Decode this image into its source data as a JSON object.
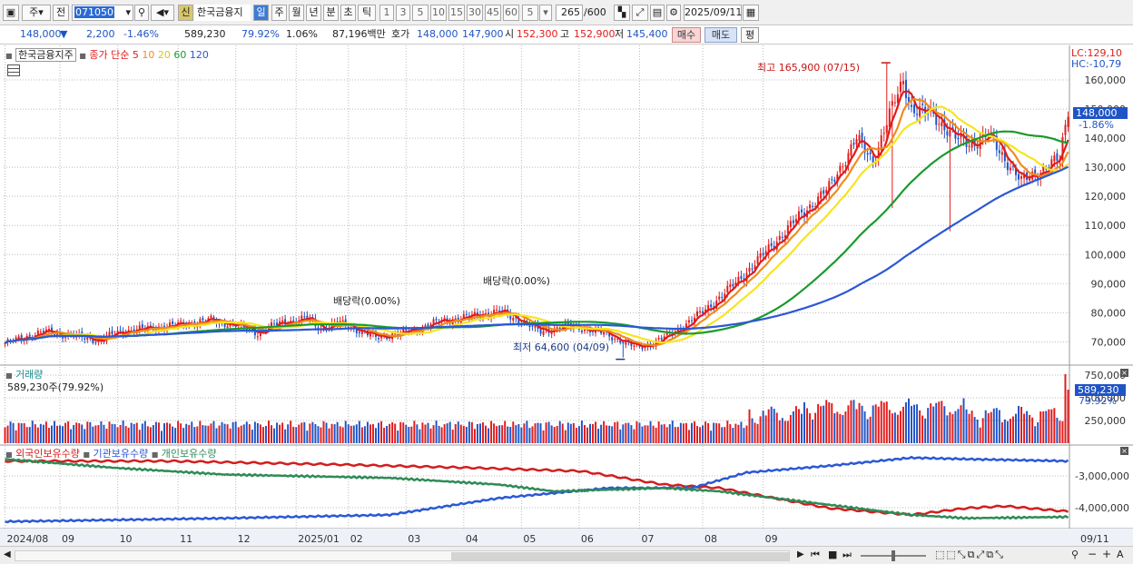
{
  "toolbar": {
    "market_label": "주",
    "prev_label": "전",
    "stock_code": "071050",
    "stock_name": "한국금융지",
    "new_badge": "신",
    "periods": [
      "일",
      "주",
      "월",
      "년",
      "분",
      "초",
      "틱"
    ],
    "minute_buttons": [
      "1",
      "3",
      "5",
      "10",
      "15",
      "30",
      "45",
      "60"
    ],
    "custom_period": "5",
    "count_value": "265",
    "count_total": "/600",
    "date_value": "2025/09/11"
  },
  "info": {
    "price": "148,000",
    "down_arrow": "▼",
    "change": "2,200",
    "change_pct": "-1.46%",
    "volume": "589,230",
    "volume_ratio": "79.92%",
    "turnover_rate": "1.06%",
    "trade_amount": "87,196백만",
    "bid_label": "호가",
    "bid_price": "148,000",
    "ask_price": "147,900",
    "open_label": "시",
    "open_price": "152,300",
    "high_label": "고",
    "high_price": "152,900",
    "low_label": "저",
    "low_price": "145,400",
    "buy_label": "매수",
    "sell_label": "매도",
    "eval_label": "평"
  },
  "main_legend": {
    "name": "한국금융지주",
    "ma_title": "종가 단순",
    "ma5": "5",
    "ma10": "10",
    "ma20": "20",
    "ma60": "60",
    "ma120": "120"
  },
  "main_right": {
    "lc": "LC:129,10",
    "hc": "HC:-10,79",
    "current_price": "148,000",
    "current_change": "-1.86%"
  },
  "annotations": {
    "high": "최고 165,900 (07/15)",
    "low": "최저 64,600 (04/09)",
    "dividend1": "배당락(0.00%)",
    "dividend2": "배당락(0.00%)"
  },
  "volume_legend": {
    "title": "거래량",
    "value": "589,230주(79.92%)",
    "current": "589,230",
    "current_pct": "79.92%"
  },
  "holding_legend": {
    "foreign": "외국인보유수량",
    "institution": "기관보유수량",
    "individual": "개인보유수량"
  },
  "x_labels": [
    "2024/08",
    "09",
    "10",
    "11",
    "12",
    "2025/01",
    "02",
    "03",
    "04",
    "05",
    "06",
    "07",
    "08",
    "09",
    "09/11"
  ],
  "colors": {
    "up": "#e21b1b",
    "down": "#1f54c6",
    "ma5": "#e21b1b",
    "ma10": "#f08c1e",
    "ma20": "#f5e51e",
    "ma60": "#1a9a2c",
    "ma120": "#2b58d6",
    "institution": "#2b58d6",
    "foreign": "#d21e1e",
    "individual": "#2e8b57"
  },
  "chart_data": [
    {
      "type": "candlestick",
      "title": "한국금융지주",
      "ylim": [
        62000,
        170000
      ],
      "y_ticks": [
        70000,
        80000,
        90000,
        100000,
        110000,
        120000,
        130000,
        140000,
        150000,
        160000
      ],
      "y_tick_labels": [
        "70,000",
        "80,000",
        "90,000",
        "100,000",
        "110,000",
        "120,000",
        "130,000",
        "140,000",
        "150,000",
        "160,000"
      ],
      "grid": true,
      "anchors": [
        [
          0,
          69500
        ],
        [
          14,
          73500
        ],
        [
          25,
          72000
        ],
        [
          34,
          70500
        ],
        [
          42,
          73500
        ],
        [
          60,
          75500
        ],
        [
          75,
          77500
        ],
        [
          85,
          75500
        ],
        [
          92,
          73000
        ],
        [
          100,
          76500
        ],
        [
          110,
          78000
        ],
        [
          115,
          74500
        ],
        [
          122,
          76500
        ],
        [
          135,
          71500
        ],
        [
          144,
          73000
        ],
        [
          150,
          74500
        ],
        [
          158,
          77000
        ],
        [
          168,
          78500
        ],
        [
          180,
          80500
        ],
        [
          188,
          77000
        ],
        [
          195,
          73500
        ],
        [
          206,
          75500
        ],
        [
          218,
          73000
        ],
        [
          230,
          68000
        ],
        [
          237,
          70000
        ],
        [
          248,
          76000
        ],
        [
          260,
          85000
        ],
        [
          270,
          94000
        ],
        [
          280,
          104000
        ],
        [
          290,
          114000
        ],
        [
          300,
          123000
        ],
        [
          310,
          140000
        ],
        [
          316,
          132000
        ],
        [
          322,
          148000
        ],
        [
          327,
          160000
        ],
        [
          330,
          150000
        ],
        [
          338,
          148000
        ],
        [
          346,
          140000
        ],
        [
          352,
          138000
        ],
        [
          358,
          141000
        ],
        [
          364,
          133000
        ],
        [
          370,
          125000
        ],
        [
          376,
          128500
        ],
        [
          380,
          130500
        ],
        [
          384,
          133000
        ],
        [
          387,
          150000
        ]
      ],
      "extremes": [
        {
          "label": "최고",
          "value": 165900,
          "date": "07/15"
        },
        {
          "label": "최저",
          "value": 64600,
          "date": "04/09"
        }
      ],
      "series": [
        {
          "name": "5"
        },
        {
          "name": "10"
        },
        {
          "name": "20"
        },
        {
          "name": "60"
        },
        {
          "name": "120"
        }
      ]
    },
    {
      "type": "bar",
      "title": "거래량",
      "ylim": [
        0,
        800000
      ],
      "y_ticks": [
        250000,
        500000,
        750000
      ],
      "y_tick_labels": [
        "250,000",
        "500,000",
        "750,000"
      ],
      "last_value": 589230
    },
    {
      "type": "line",
      "title": "보유수량",
      "y_ticks": [
        -3000000,
        -4000000
      ],
      "y_tick_labels": [
        "-3,000,000",
        "-4,000,000"
      ],
      "series": [
        {
          "name": "외국인보유수량",
          "points": [
            [
              0,
              0.05
            ],
            [
              60,
              0.05
            ],
            [
              120,
              0.1
            ],
            [
              170,
              0.15
            ],
            [
              210,
              0.2
            ],
            [
              240,
              0.4
            ],
            [
              260,
              0.45
            ],
            [
              300,
              0.75
            ],
            [
              330,
              0.85
            ],
            [
              350,
              0.75
            ],
            [
              364,
              0.72
            ],
            [
              387,
              0.8
            ]
          ]
        },
        {
          "name": "기관보유수량",
          "points": [
            [
              0,
              0.95
            ],
            [
              80,
              0.9
            ],
            [
              140,
              0.85
            ],
            [
              180,
              0.6
            ],
            [
              220,
              0.45
            ],
            [
              250,
              0.45
            ],
            [
              270,
              0.22
            ],
            [
              300,
              0.12
            ],
            [
              330,
              0.0
            ],
            [
              350,
              0.02
            ],
            [
              387,
              0.05
            ]
          ]
        },
        {
          "name": "개인보유수량",
          "points": [
            [
              0,
              0.02
            ],
            [
              40,
              0.15
            ],
            [
              80,
              0.25
            ],
            [
              140,
              0.3
            ],
            [
              180,
              0.4
            ],
            [
              200,
              0.5
            ],
            [
              240,
              0.45
            ],
            [
              260,
              0.5
            ],
            [
              290,
              0.65
            ],
            [
              330,
              0.85
            ],
            [
              350,
              0.9
            ],
            [
              387,
              0.88
            ]
          ]
        }
      ]
    }
  ]
}
